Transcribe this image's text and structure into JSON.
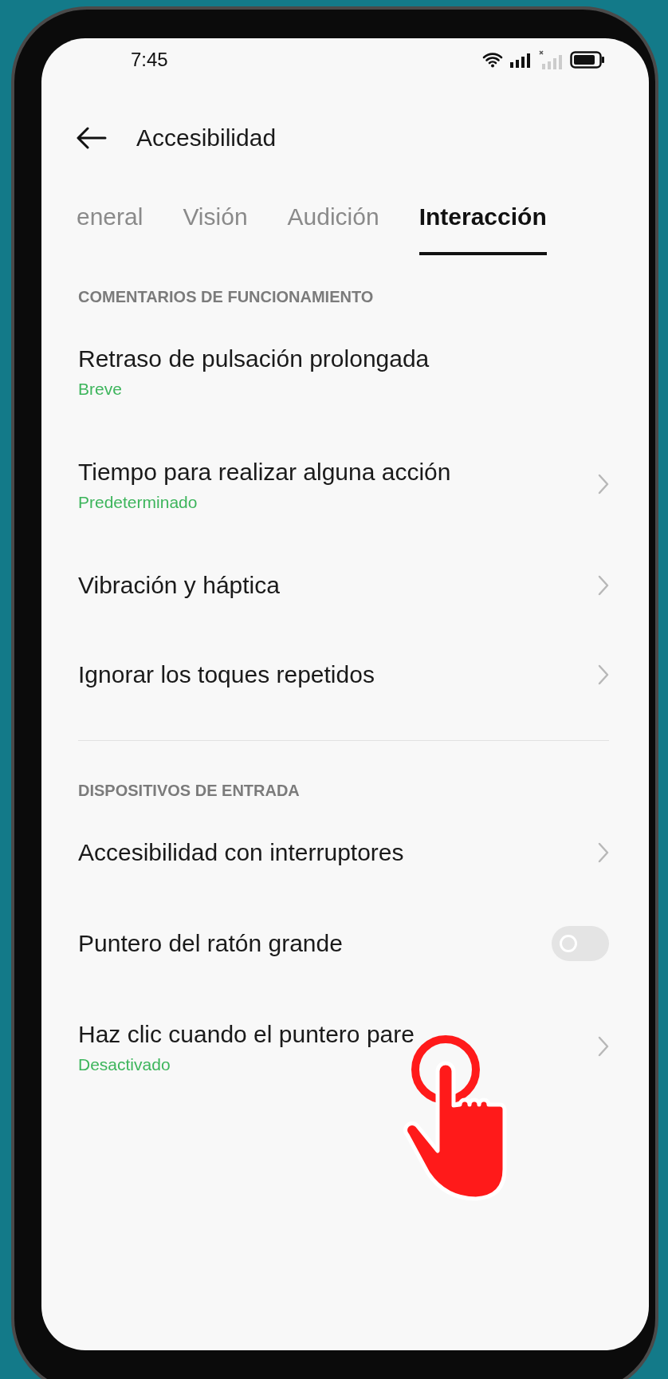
{
  "status_bar": {
    "time": "7:45"
  },
  "header": {
    "title": "Accesibilidad"
  },
  "tabs": [
    {
      "label": "eneral",
      "selected": false
    },
    {
      "label": "Visión",
      "selected": false
    },
    {
      "label": "Audición",
      "selected": false
    },
    {
      "label": "Interacción",
      "selected": true
    }
  ],
  "sections": [
    {
      "heading": "COMENTARIOS DE FUNCIONAMIENTO",
      "items": [
        {
          "kind": "plain",
          "title": "Retraso de pulsación prolongada",
          "subtitle": "Breve"
        },
        {
          "kind": "link",
          "title": "Tiempo para realizar alguna acción",
          "subtitle": "Predeterminado"
        },
        {
          "kind": "link",
          "title": "Vibración y háptica"
        },
        {
          "kind": "link",
          "title": "Ignorar los toques repetidos"
        }
      ]
    },
    {
      "heading": "DISPOSITIVOS DE ENTRADA",
      "items": [
        {
          "kind": "link",
          "title": "Accesibilidad con interruptores"
        },
        {
          "kind": "toggle",
          "title": "Puntero del ratón grande",
          "on": false
        },
        {
          "kind": "link",
          "title": "Haz clic cuando el puntero pare",
          "subtitle": "Desactivado"
        }
      ]
    }
  ]
}
